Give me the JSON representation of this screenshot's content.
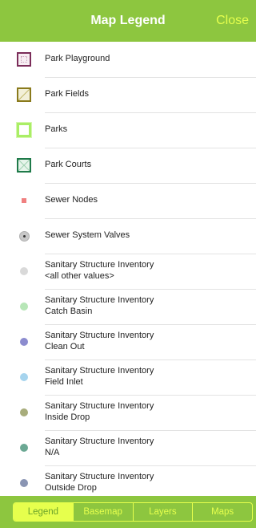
{
  "header": {
    "title": "Map Legend",
    "close_label": "Close"
  },
  "legend_items": [
    {
      "label_line1": "Park Playground",
      "label_line2": "",
      "symbol": "park-playground-square-icon",
      "border": "#7b2d5a",
      "fill": "#f7eef3"
    },
    {
      "label_line1": "Park Fields",
      "label_line2": "",
      "symbol": "park-fields-square-icon",
      "border": "#8a7a1c",
      "fill": "#f2f0d8"
    },
    {
      "label_line1": "Parks",
      "label_line2": "",
      "symbol": "parks-square-icon",
      "border": "#aaee66",
      "fill": "#ffffff"
    },
    {
      "label_line1": "Park Courts",
      "label_line2": "",
      "symbol": "park-courts-square-icon",
      "border": "#1f7a4a",
      "fill": "#e6f4ea"
    },
    {
      "label_line1": "Sewer Nodes",
      "label_line2": "",
      "symbol": "sewer-node-marker-icon",
      "color": "#f08080"
    },
    {
      "label_line1": "Sewer System Valves",
      "label_line2": "",
      "symbol": "sewer-valve-marker-icon",
      "color": "#c8c8c8"
    },
    {
      "label_line1": "Sanitary Structure Inventory",
      "label_line2": "<all other values>",
      "symbol": "dot-icon",
      "color": "#d9d9d9"
    },
    {
      "label_line1": "Sanitary Structure Inventory",
      "label_line2": "Catch Basin",
      "symbol": "dot-icon",
      "color": "#b7e6b7"
    },
    {
      "label_line1": "Sanitary Structure Inventory",
      "label_line2": "Clean Out",
      "symbol": "dot-icon",
      "color": "#8c8ccf"
    },
    {
      "label_line1": "Sanitary Structure Inventory",
      "label_line2": "Field Inlet",
      "symbol": "dot-icon",
      "color": "#a6d4ee"
    },
    {
      "label_line1": "Sanitary Structure Inventory",
      "label_line2": "Inside Drop",
      "symbol": "dot-icon",
      "color": "#a8ad7c"
    },
    {
      "label_line1": "Sanitary Structure Inventory",
      "label_line2": "N/A",
      "symbol": "dot-icon",
      "color": "#6ba893"
    },
    {
      "label_line1": "Sanitary Structure Inventory",
      "label_line2": "Outside Drop",
      "symbol": "dot-icon",
      "color": "#8a95b3"
    }
  ],
  "tabs": [
    {
      "label": "Legend",
      "active": true
    },
    {
      "label": "Basemap",
      "active": false
    },
    {
      "label": "Layers",
      "active": false
    },
    {
      "label": "Maps",
      "active": false
    }
  ],
  "colors": {
    "accent": "#8dc63f",
    "highlight": "#e6ff4d"
  }
}
